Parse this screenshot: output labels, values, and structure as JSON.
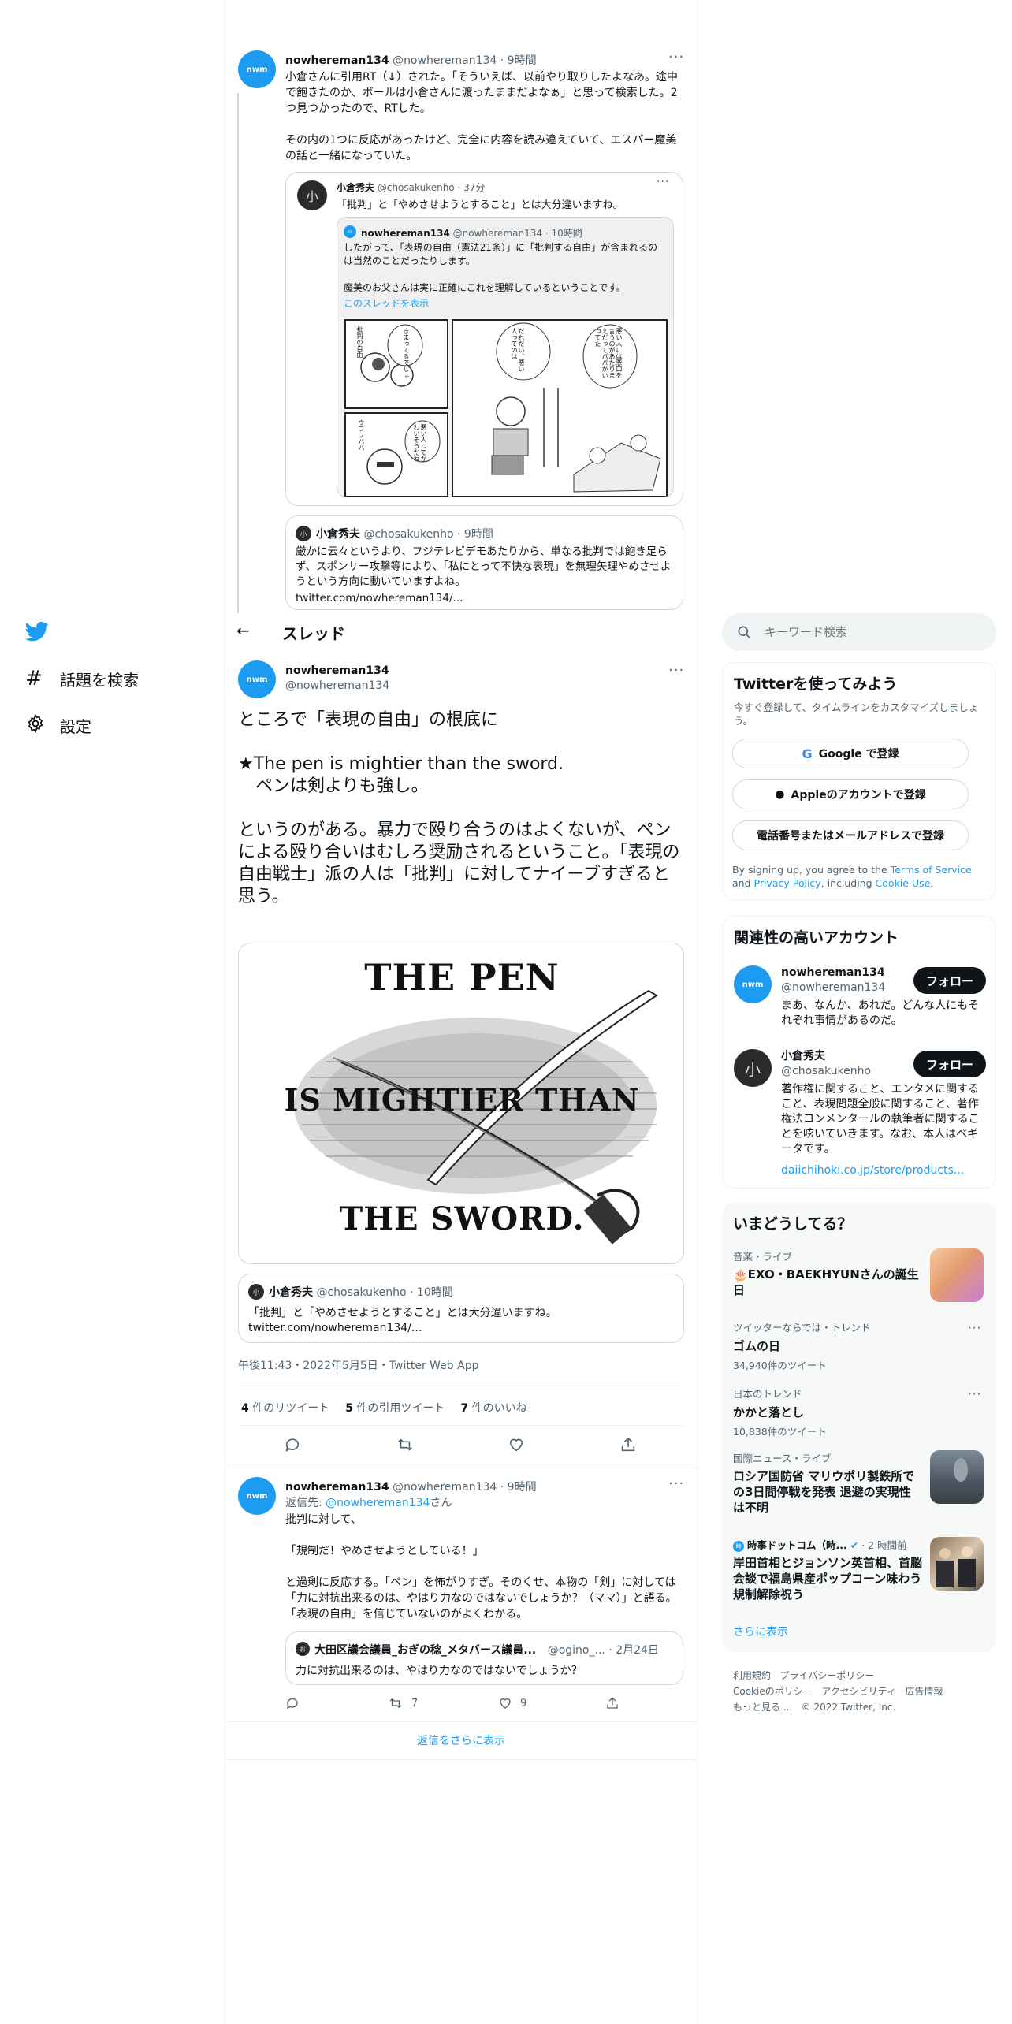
{
  "nav": {
    "search_label": "話題を検索",
    "settings_label": "設定"
  },
  "header": {
    "title": "スレッド"
  },
  "search": {
    "placeholder": "キーワード検索"
  },
  "thread_top": {
    "author_name": "nowhereman134",
    "author_handle": "@nowhereman134",
    "time": "9時間",
    "text": "小倉さんに引用RT（↓）された。「そういえば、以前やり取りしたよなあ。途中で飽きたのか、ボールは小倉さんに渡ったままだよなぁ」と思って検索した。2つ見つかったので、RTした。\n\nその内の1つに反応があったけど、完全に内容を読み違えていて、エスパー魔美の話と一緒になっていた。",
    "quote": {
      "author_name": "小倉秀夫",
      "author_handle": "@chosakukenho",
      "time": "37分",
      "text": "「批判」と「やめさせようとすること」とは大分違いますね。",
      "inner": {
        "author_name": "nowhereman134",
        "author_handle": "@nowhereman134",
        "time": "10時間",
        "text": "したがって、「表現の自由（憲法21条）」に「批判する自由」が含まれるのは当然のことだったりします。\n\n魔美のお父さんは実に正確にこれを理解しているということです。",
        "show_thread": "このスレッドを表示"
      },
      "manga": {
        "p1": "きまってるでしょ",
        "p2": "だれだい、悪い人ってのは",
        "p3": "悪い人には悪口を言うのがあたりまえだってパパがいってた",
        "p4": "悪い人ってかわいそうだね",
        "p5": "批判の自由",
        "p6": "ウフフハハ"
      }
    },
    "quote2": {
      "author_name": "小倉秀夫",
      "author_handle": "@chosakukenho",
      "time": "9時間",
      "text": "厳かに云々というより、フジテレビデモあたりから、単なる批判では飽き足らず、スポンサー攻撃等により、「私にとって不快な表現」を無理矢理やめさせようという方向に動いていますよね。",
      "link": "twitter.com/nowhereman134/..."
    }
  },
  "main_tweet": {
    "author_name": "nowhereman134",
    "author_handle": "@nowhereman134",
    "text": "ところで「表現の自由」の根底に\n\n★The pen is mightier than the sword.\n　ペンは剣よりも強し。\n\nというのがある。暴力で殴り合うのはよくないが、ペンによる殴り合いはむしろ奨励されるということ。「表現の自由戦士」派の人は「批判」に対してナイーブすぎると思う。",
    "image_text": {
      "line1": "THE PEN",
      "line2": "IS MIGHTIER THAN",
      "line3": "THE SWORD."
    },
    "quote": {
      "author_name": "小倉秀夫",
      "author_handle": "@chosakukenho",
      "time": "10時間",
      "text": "「批判」と「やめさせようとすること」とは大分違いますね。",
      "link": "twitter.com/nowhereman134/..."
    },
    "meta": "午後11:43・2022年5月5日・Twitter Web App",
    "stats": {
      "retweets": "4",
      "retweets_label": "件のリツイート",
      "quotes": "5",
      "quotes_label": "件の引用ツイート",
      "likes": "7",
      "likes_label": "件のいいね"
    }
  },
  "reply": {
    "author_name": "nowhereman134",
    "author_handle": "@nowhereman134",
    "time": "9時間",
    "reply_to_prefix": "返信先: ",
    "reply_to_handle": "@nowhereman134",
    "reply_to_suffix": "さん",
    "text": "批判に対して、\n\n「規制だ！やめさせようとしている！」\n\nと過剰に反応する。「ペン」を怖がりすぎ。そのくせ、本物の「剣」に対しては「力に対抗出来るのは、やはり力なのではないでしょうか？（ママ）」と語る。「表現の自由」を信じていないのがよくわかる。",
    "quote": {
      "author_name": "大田区議会議員_おぎの稔_メタバース議員...",
      "author_handle": "@ogino_...",
      "time": "2月24日",
      "text": "力に対抗出来るのは、やはり力なのではないでしょうか？"
    },
    "retweet_count": "7",
    "like_count": "9"
  },
  "show_more_replies": "返信をさらに表示",
  "signup": {
    "title": "Twitterを使ってみよう",
    "subtitle": "今すぐ登録して、タイムラインをカスタマイズしましょう。",
    "google": "Google で登録",
    "apple": "Appleのアカウントで登録",
    "phone": "電話番号またはメールアドレスで登録",
    "terms_1": "By signing up, you agree to the ",
    "terms_link1": "Terms of Service",
    "terms_2": " and ",
    "terms_link2": "Privacy Policy",
    "terms_3": ", including ",
    "terms_link3": "Cookie Use",
    "terms_4": "."
  },
  "related": {
    "title": "関連性の高いアカウント",
    "follow_label": "フォロー",
    "accounts": [
      {
        "name": "nowhereman134",
        "handle": "@nowhereman134",
        "bio": "まあ、なんか、あれだ。どんな人にもそれぞれ事情があるのだ。"
      },
      {
        "name": "小倉秀夫",
        "handle": "@chosakukenho",
        "bio": "著作権に関すること、エンタメに関すること、表現問題全般に関すること、著作権法コンメンタールの執筆者に関することを呟いていきます。なお、本人はベギータです。",
        "link": "daiichihoki.co.jp/store/products..."
      }
    ]
  },
  "trends": {
    "title": "いまどうしてる？",
    "items": [
      {
        "context": "音楽・ライブ",
        "title": "🎂EXO・BAEKHYUNさんの誕生日"
      },
      {
        "context": "ツイッターならでは・トレンド",
        "title": "ゴムの日",
        "count": "34,940件のツイート"
      },
      {
        "context": "日本のトレンド",
        "title": "かかと落とし",
        "count": "10,838件のツイート"
      },
      {
        "context": "国際ニュース・ライブ",
        "title": "ロシア国防省 マリウポリ製鉄所での3日間停戦を発表 退避の実現性は不明"
      },
      {
        "source": "時事ドットコム（時...",
        "time": "2 時間前",
        "title": "岸田首相とジョンソン英首相、首脳会談で福島県産ポップコーン味わう　規制解除祝う"
      }
    ],
    "show_more": "さらに表示"
  },
  "footer": {
    "l1": "利用規約",
    "l2": "プライバシーポリシー",
    "l3": "Cookieのポリシー",
    "l4": "アクセシビリティ",
    "l5": "広告情報",
    "l6": "もっと見る ...",
    "copyright": "© 2022 Twitter, Inc."
  },
  "colors": {
    "accent": "#1d9bf0",
    "text": "#0f1419",
    "muted": "#536471",
    "border": "#cfd9de"
  }
}
